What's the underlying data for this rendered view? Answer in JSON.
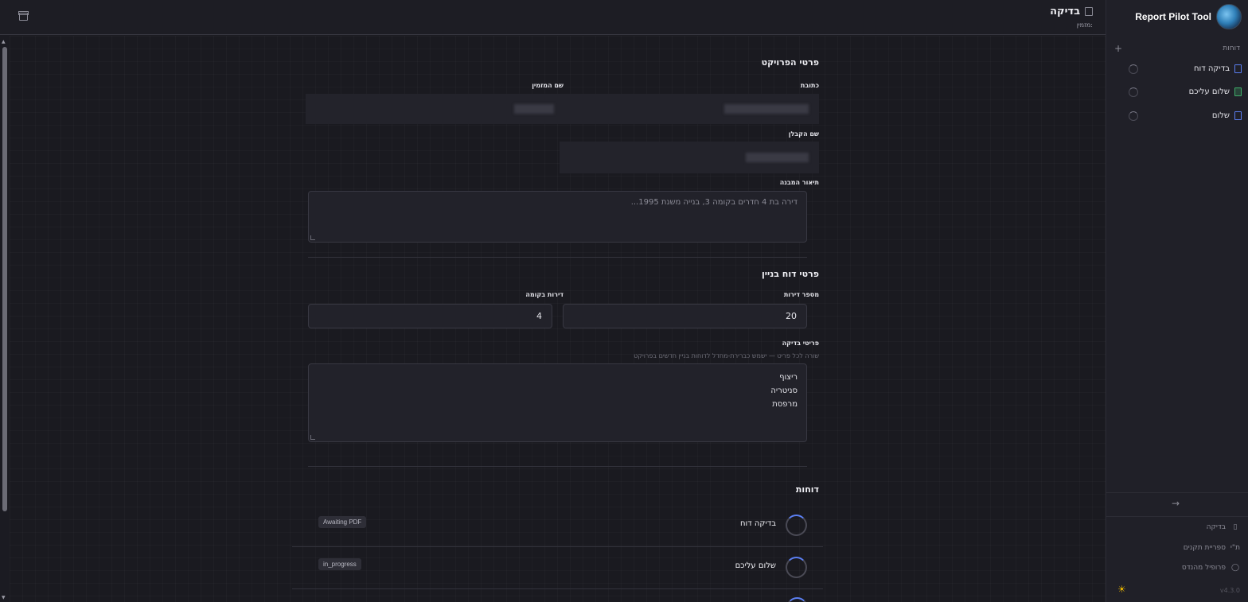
{
  "app": {
    "name": "Report Pilot Tool",
    "version": "v4.3.0"
  },
  "sidebar": {
    "section_label": "דוחות",
    "add_symbol": "+",
    "items": [
      {
        "label": "בדיקה דוח",
        "icon": "document-icon"
      },
      {
        "label": "שלום עליכם",
        "icon": "spreadsheet-icon"
      },
      {
        "label": "שלום",
        "icon": "document-icon"
      }
    ],
    "collapse_symbol": "→",
    "bottom": [
      {
        "label": "בדיקה",
        "icon": "document-icon"
      },
      {
        "label": "ספריית תקנים",
        "icon": "library-icon",
        "glyph": "ת\"י"
      },
      {
        "label": "פרופיל מהנדס",
        "icon": "user-icon"
      }
    ]
  },
  "header": {
    "title": "בדיקה",
    "subtitle": "מזמין:"
  },
  "project": {
    "section_title": "פרטי הפרויקט",
    "address_label": "כתובת",
    "client_label": "שם המזמין",
    "contractor_label": "שם הקבלן",
    "building_desc_label": "תיאור המבנה",
    "building_desc_placeholder": "דירה בת 4 חדרים בקומה 3, בנייה משנת 1995..."
  },
  "building": {
    "section_title": "פרטי דוח בניין",
    "apartments_label": "מספר דירות",
    "apartments_value": "20",
    "per_floor_label": "דירות בקומה",
    "per_floor_value": "4",
    "items_label": "פריטי בדיקה",
    "items_help": "שורה לכל פריט — ישמש כברירת-מחדל לדוחות בניין חדשים בפרויקט",
    "items": [
      "ריצוף",
      "סניטריה",
      "מרפסת"
    ]
  },
  "reports": {
    "section_title": "דוחות",
    "rows": [
      {
        "name": "בדיקה דוח",
        "status": "Awaiting PDF"
      },
      {
        "name": "שלום עליכם",
        "status": "in_progress"
      }
    ]
  },
  "colors": {
    "accent": "#5b7ff2",
    "success": "#3fae6a",
    "background": "#1b1b22",
    "sun": "#e8b400"
  }
}
